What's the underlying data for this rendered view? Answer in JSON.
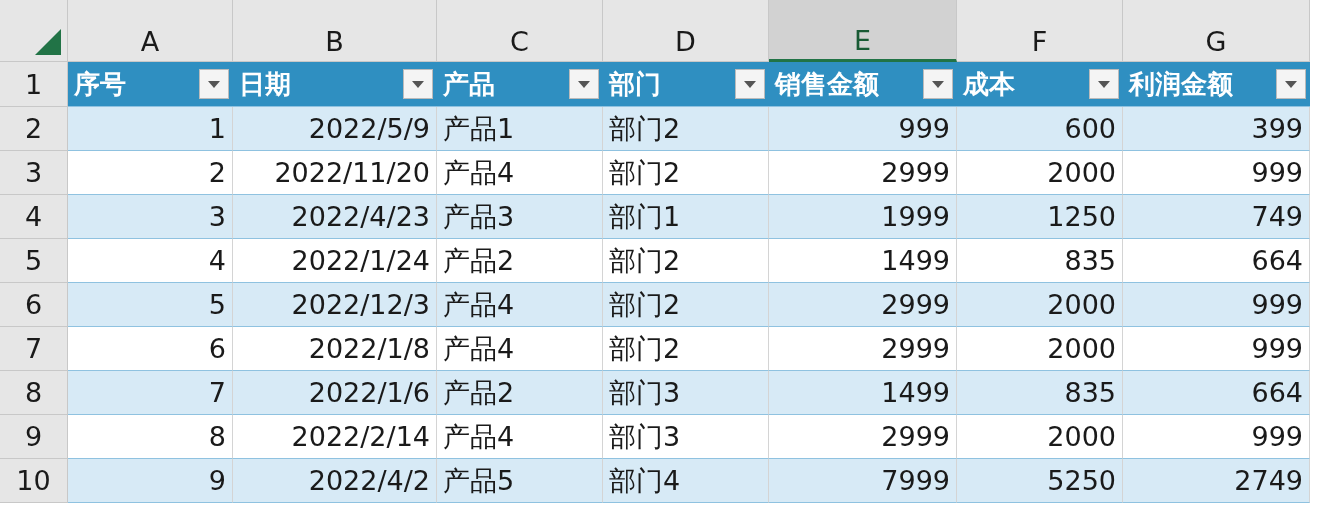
{
  "columns": [
    {
      "letter": "A",
      "selected": false
    },
    {
      "letter": "B",
      "selected": false
    },
    {
      "letter": "C",
      "selected": false
    },
    {
      "letter": "D",
      "selected": false
    },
    {
      "letter": "E",
      "selected": true
    },
    {
      "letter": "F",
      "selected": false
    },
    {
      "letter": "G",
      "selected": false
    }
  ],
  "table": {
    "header_row": "1",
    "headers": [
      {
        "label": "序号"
      },
      {
        "label": "日期"
      },
      {
        "label": "产品"
      },
      {
        "label": "部门"
      },
      {
        "label": "销售金额"
      },
      {
        "label": "成本"
      },
      {
        "label": "利润金额"
      }
    ],
    "rows": [
      {
        "row": "2",
        "cells": [
          "1",
          "2022/5/9",
          "产品1",
          "部门2",
          "999",
          "600",
          "399"
        ]
      },
      {
        "row": "3",
        "cells": [
          "2",
          "2022/11/20",
          "产品4",
          "部门2",
          "2999",
          "2000",
          "999"
        ]
      },
      {
        "row": "4",
        "cells": [
          "3",
          "2022/4/23",
          "产品3",
          "部门1",
          "1999",
          "1250",
          "749"
        ]
      },
      {
        "row": "5",
        "cells": [
          "4",
          "2022/1/24",
          "产品2",
          "部门2",
          "1499",
          "835",
          "664"
        ]
      },
      {
        "row": "6",
        "cells": [
          "5",
          "2022/12/3",
          "产品4",
          "部门2",
          "2999",
          "2000",
          "999"
        ]
      },
      {
        "row": "7",
        "cells": [
          "6",
          "2022/1/8",
          "产品4",
          "部门2",
          "2999",
          "2000",
          "999"
        ]
      },
      {
        "row": "8",
        "cells": [
          "7",
          "2022/1/6",
          "产品2",
          "部门3",
          "1499",
          "835",
          "664"
        ]
      },
      {
        "row": "9",
        "cells": [
          "8",
          "2022/2/14",
          "产品4",
          "部门3",
          "2999",
          "2000",
          "999"
        ]
      },
      {
        "row": "10",
        "cells": [
          "9",
          "2022/4/2",
          "产品5",
          "部门4",
          "7999",
          "5250",
          "2749"
        ]
      }
    ]
  }
}
